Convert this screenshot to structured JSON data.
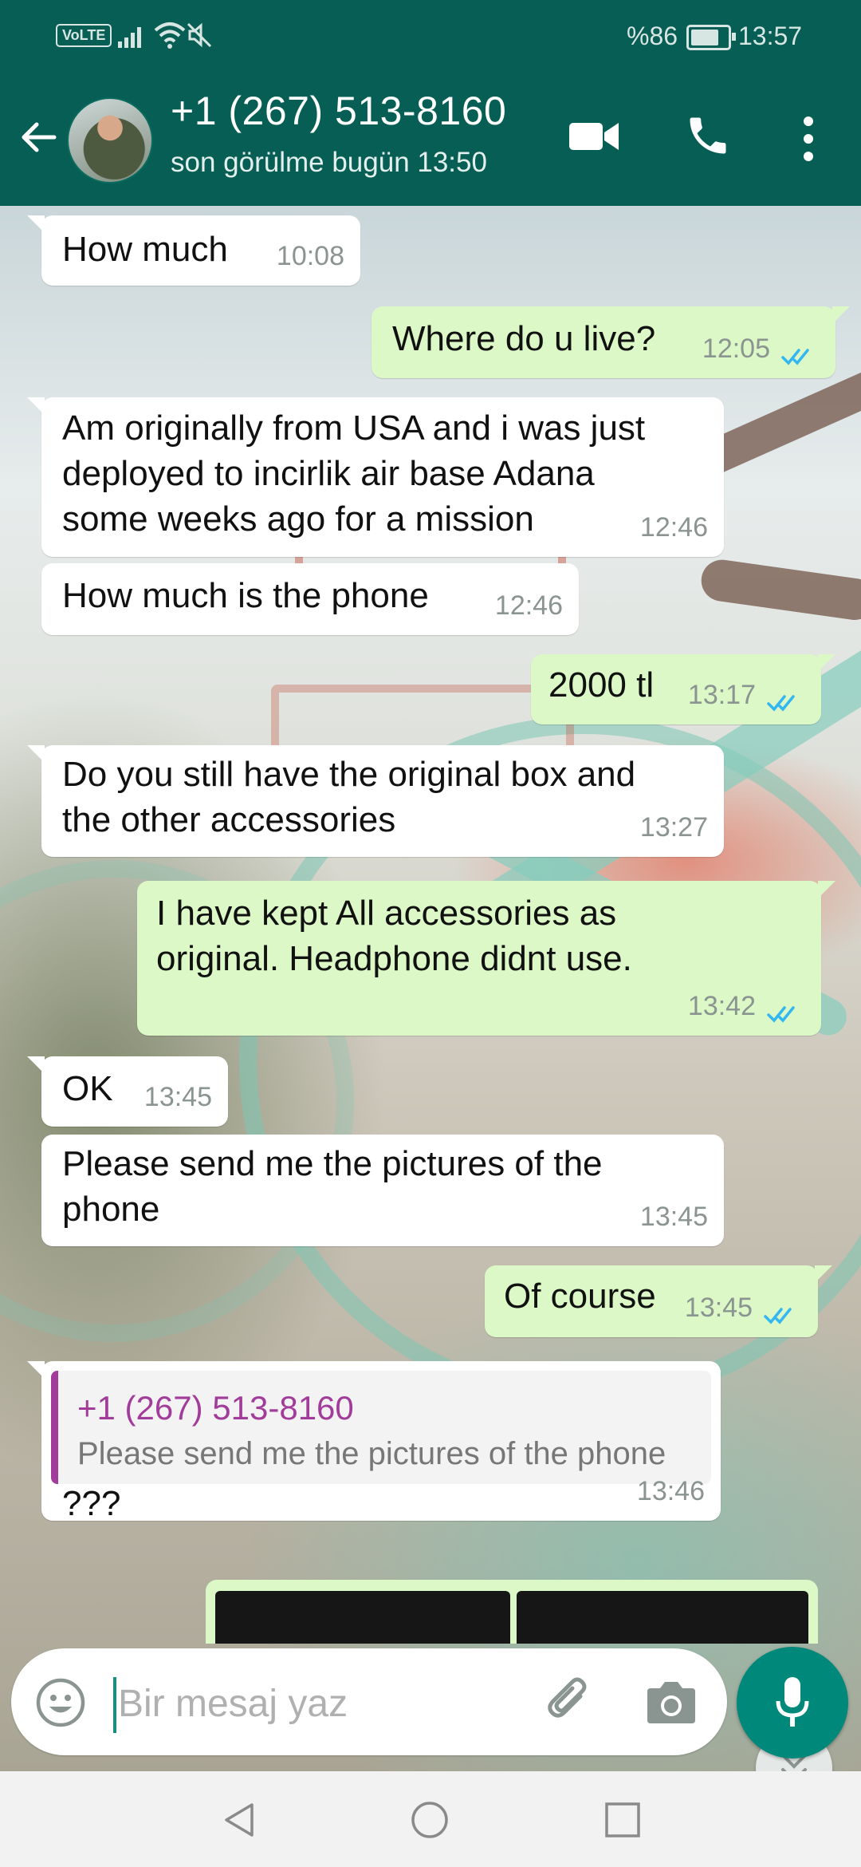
{
  "status_bar": {
    "volte": "VoLTE",
    "battery_percent": "%86",
    "battery_level": 0.86,
    "time": "13:57"
  },
  "header": {
    "contact_name": "+1 (267) 513-8160",
    "last_seen": "son görülme bugün 13:50",
    "icons": [
      "back-arrow-icon",
      "video-call-icon",
      "phone-call-icon",
      "more-options-icon"
    ]
  },
  "messages": [
    {
      "dir": "in",
      "text": "How much",
      "time": "10:08"
    },
    {
      "dir": "out",
      "text": "Where do u live?",
      "time": "12:05",
      "status": "read"
    },
    {
      "dir": "in",
      "text": "Am originally from USA and i was just\ndeployed to incirlik air base Adana\nsome weeks ago for a mission",
      "time": "12:46"
    },
    {
      "dir": "in",
      "text": "How much is the phone",
      "time": "12:46"
    },
    {
      "dir": "out",
      "text": "2000 tl",
      "time": "13:17",
      "status": "read"
    },
    {
      "dir": "in",
      "text": "Do you still have the original box and\nthe other accessories",
      "time": "13:27"
    },
    {
      "dir": "out",
      "text": "I have kept All accessories as\noriginal. Headphone didnt use.",
      "time": "13:42",
      "status": "read"
    },
    {
      "dir": "in",
      "text": "OK",
      "time": "13:45"
    },
    {
      "dir": "in",
      "text": "Please send me the pictures of the\nphone",
      "time": "13:45"
    },
    {
      "dir": "out",
      "text": "Of course",
      "time": "13:45",
      "status": "read"
    },
    {
      "dir": "in",
      "text": "???",
      "time": "13:46",
      "quote": {
        "name": "+1 (267) 513-8160",
        "text": "Please send me the pictures of the phone"
      }
    }
  ],
  "input": {
    "placeholder": "Bir mesaj yaz",
    "value": ""
  },
  "colors": {
    "header": "#075e54",
    "outgoing_bubble": "#dcf8c6",
    "incoming_bubble": "#ffffff",
    "read_ticks": "#34b7f1",
    "mic_button": "#00897b",
    "quote_accent": "#a23c9a"
  }
}
